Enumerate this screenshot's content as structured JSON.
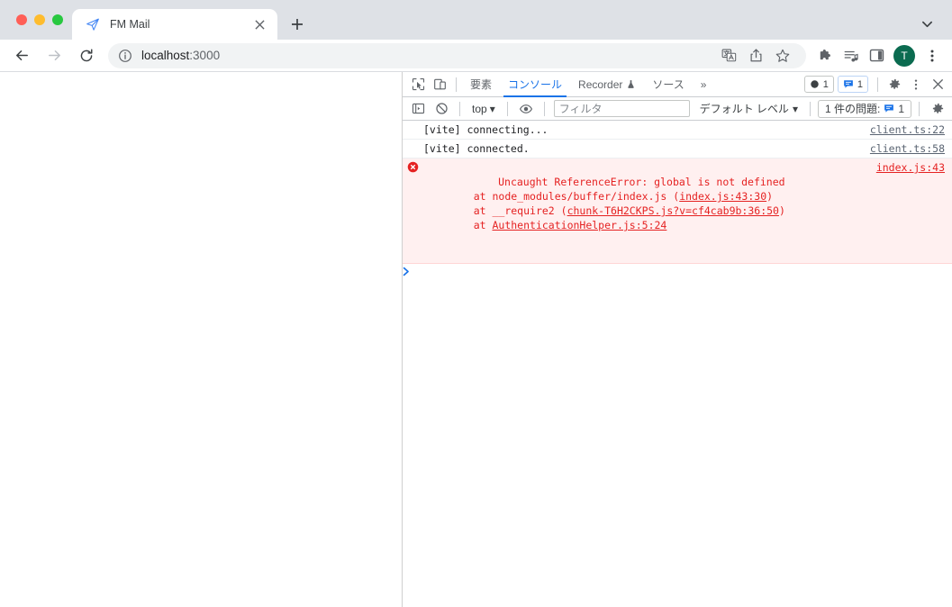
{
  "window": {
    "traffic_lights": [
      "close",
      "minimize",
      "zoom"
    ],
    "colors": {
      "close": "#ff5f57",
      "minimize": "#febc2e",
      "zoom": "#28c840",
      "tabstrip_bg": "#dee1e6",
      "accent_blue": "#1a73e8",
      "error_red": "#e52222",
      "error_bg": "#fff0f0",
      "avatar_bg": "#0b6b50"
    }
  },
  "tabstrip": {
    "tab": {
      "title": "FM Mail",
      "favicon": "paper-plane-icon",
      "close_label": "×"
    },
    "new_tab_label": "+",
    "tab_list_label": "⌄"
  },
  "toolbar": {
    "back_label": "←",
    "forward_label": "→",
    "reload_label": "⟳",
    "omnibox": {
      "security_icon": "info-circle-icon",
      "host": "localhost",
      "port": ":3000",
      "full_url": "localhost:3000"
    },
    "actions": [
      {
        "name": "translate-icon",
        "label": "翻訳"
      },
      {
        "name": "share-icon",
        "label": "共有"
      },
      {
        "name": "bookmark-star-icon",
        "label": "ブックマーク"
      },
      {
        "name": "extensions-puzzle-icon",
        "label": "拡張機能"
      },
      {
        "name": "reading-list-icon",
        "label": "リーディング リスト"
      },
      {
        "name": "side-panel-icon",
        "label": "サイドパネル"
      }
    ],
    "profile_initial": "T",
    "menu_label": "⋮"
  },
  "devtools": {
    "left_icons": [
      {
        "name": "inspect-element-icon",
        "label": "要素を選択して検査"
      },
      {
        "name": "device-toolbar-icon",
        "label": "デバイス ツールバー"
      }
    ],
    "tabs": [
      {
        "label": "要素",
        "active": false,
        "icon": null
      },
      {
        "label": "コンソール",
        "active": true,
        "icon": null
      },
      {
        "label": "Recorder",
        "active": false,
        "icon": "experiment-flask-icon"
      },
      {
        "label": "ソース",
        "active": false,
        "icon": null
      }
    ],
    "overflow_label": "»",
    "badges": [
      {
        "name": "error-count-badge",
        "icon": "error-dot-icon",
        "count": "1"
      },
      {
        "name": "issues-count-badge",
        "icon": "issues-icon",
        "count": "1"
      }
    ],
    "settings_label": "⚙",
    "more_label": "⋮",
    "close_label": "×",
    "console_bar": {
      "sidebar_toggle": "console-sidebar-icon",
      "clear_console": "clear-console-icon",
      "context": "top",
      "context_caret": "▾",
      "eye_icon": "live-expression-eye-icon",
      "filter_placeholder": "フィルタ",
      "filter_value": "",
      "level": "デフォルト レベル",
      "level_caret": "▾",
      "issues_text": "1 件の問題:",
      "issues_count": "1",
      "settings_icon": "gear-icon"
    },
    "messages": [
      {
        "type": "log",
        "icon": null,
        "text": "[vite] connecting...",
        "link": "client.ts:22"
      },
      {
        "type": "log",
        "icon": null,
        "text": "[vite] connected.",
        "link": "client.ts:58"
      },
      {
        "type": "error",
        "icon": "error-circle-icon",
        "text": "Uncaught ReferenceError: global is not defined",
        "link": "index.js:43",
        "stack": [
          {
            "prefix": "    at node_modules/buffer/index.js (",
            "link": "index.js:43:30",
            "suffix": ")"
          },
          {
            "prefix": "    at __require2 (",
            "link": "chunk-T6H2CKPS.js?v=cf4cab9b:36:50",
            "suffix": ")"
          },
          {
            "prefix": "    at ",
            "link": "AuthenticationHelper.js:5:24",
            "suffix": ""
          }
        ]
      }
    ],
    "prompt_caret": "❯"
  },
  "page": {
    "content": ""
  }
}
